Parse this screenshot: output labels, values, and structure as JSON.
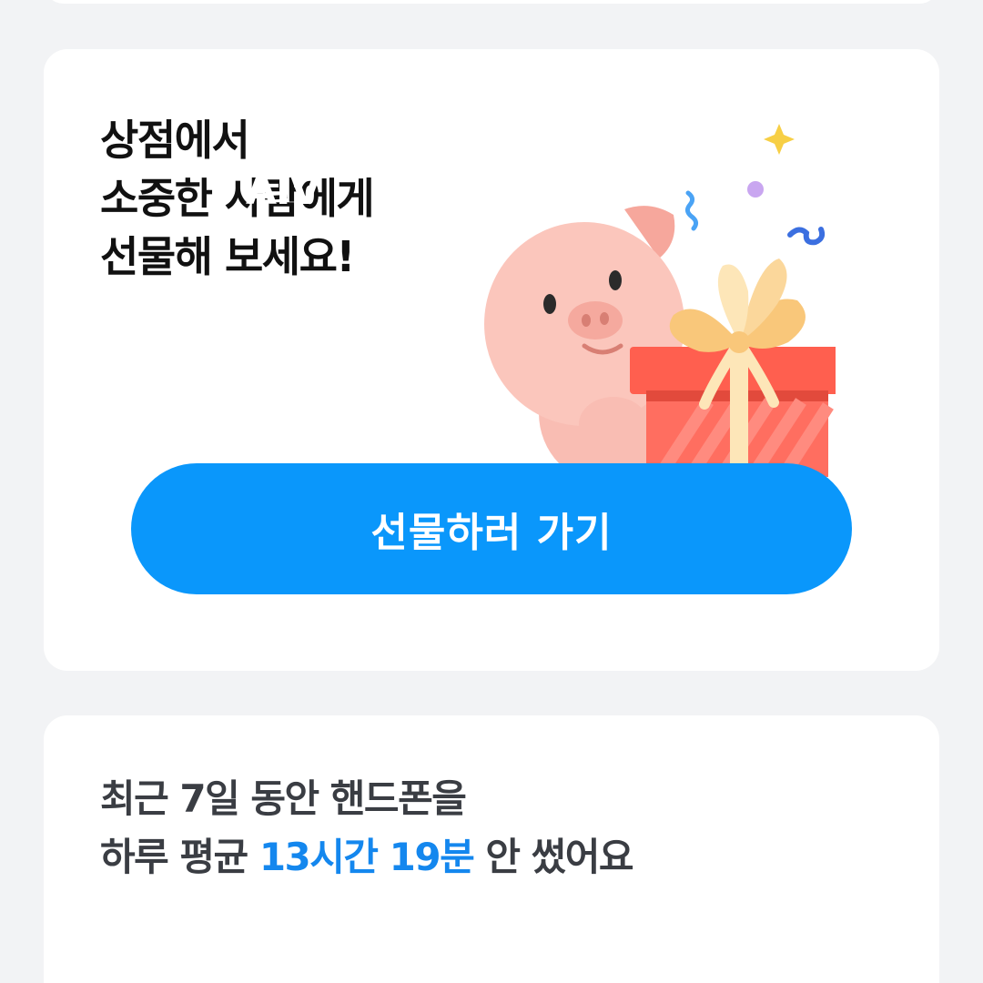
{
  "gift_card": {
    "headline_line1": "상점에서",
    "headline_line2": "소중한 사람에게",
    "headline_line3": "선물해 보세요!",
    "watermark": "AIV",
    "button_label": "선물하러 가기",
    "illustration_icon": "pig-with-gift-icon"
  },
  "usage_card": {
    "line1": "최근 7일 동안 핸드폰을",
    "line2_prefix": "하루 평균 ",
    "line2_highlight": "13시간 19분",
    "line2_suffix": " 안 썼어요"
  },
  "colors": {
    "button_blue": "#0a97fb",
    "highlight_blue": "#1487ee",
    "card_bg": "#ffffff",
    "page_bg": "#f2f3f5"
  }
}
